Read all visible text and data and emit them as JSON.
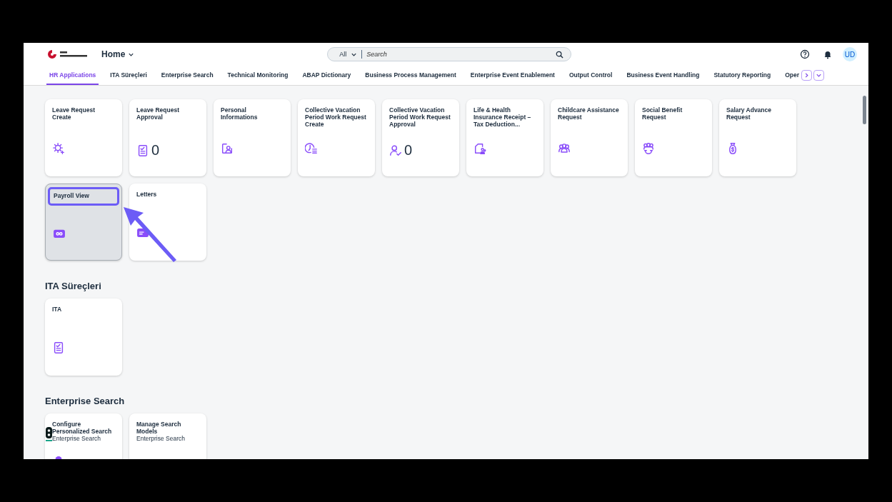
{
  "shell": {
    "home_menu": "Home",
    "search": {
      "scope": "All",
      "placeholder": "Search"
    },
    "avatar": "UD"
  },
  "tabs": [
    {
      "label": "HR Applications",
      "selected": true
    },
    {
      "label": "ITA Süreçleri",
      "selected": false
    },
    {
      "label": "Enterprise Search",
      "selected": false
    },
    {
      "label": "Technical Monitoring",
      "selected": false
    },
    {
      "label": "ABAP Dictionary",
      "selected": false
    },
    {
      "label": "Business Process Management",
      "selected": false
    },
    {
      "label": "Enterprise Event Enablement",
      "selected": false
    },
    {
      "label": "Output Control",
      "selected": false
    },
    {
      "label": "Business Event Handling",
      "selected": false
    },
    {
      "label": "Statutory Reporting",
      "selected": false
    },
    {
      "label": "Oper",
      "selected": false
    }
  ],
  "groups": [
    {
      "tiles": [
        {
          "title": "Leave Request Create",
          "kind": "sun",
          "selected": false
        },
        {
          "title": "Leave Request Approval",
          "kind": "checklist",
          "count": "0",
          "selected": false
        },
        {
          "title": "Personal Informations",
          "kind": "person-card",
          "selected": false
        },
        {
          "title": "Collective Vacation Period Work Request Create",
          "kind": "clock-list",
          "selected": false
        },
        {
          "title": "Collective Vacation Period Work Request Approval",
          "kind": "person-check",
          "count": "0",
          "selected": false
        },
        {
          "title": "Life & Health Insurance Receipt – Tax Deduction...",
          "kind": "doc-people",
          "selected": false
        },
        {
          "title": "Childcare Assistance Request",
          "kind": "group",
          "selected": false
        },
        {
          "title": "Social Benefit Request",
          "kind": "group-cycle",
          "selected": false
        },
        {
          "title": "Salary Advance Request",
          "kind": "money-bag",
          "selected": false
        },
        {
          "title": "Payroll View",
          "kind": "cash",
          "selected": true
        },
        {
          "title": "Letters",
          "kind": "card",
          "selected": false
        }
      ]
    },
    {
      "title": "ITA Süreçleri",
      "tiles": [
        {
          "title": "ITA",
          "kind": "checklist",
          "selected": false
        }
      ]
    },
    {
      "title": "Enterprise Search",
      "tiles": [
        {
          "title": "Configure Personalized Search",
          "subtitle": "Enterprise Search",
          "kind": "dot",
          "selected": false
        },
        {
          "title": "Manage Search Models",
          "subtitle": "Enterprise Search",
          "selected": false
        }
      ]
    }
  ]
}
